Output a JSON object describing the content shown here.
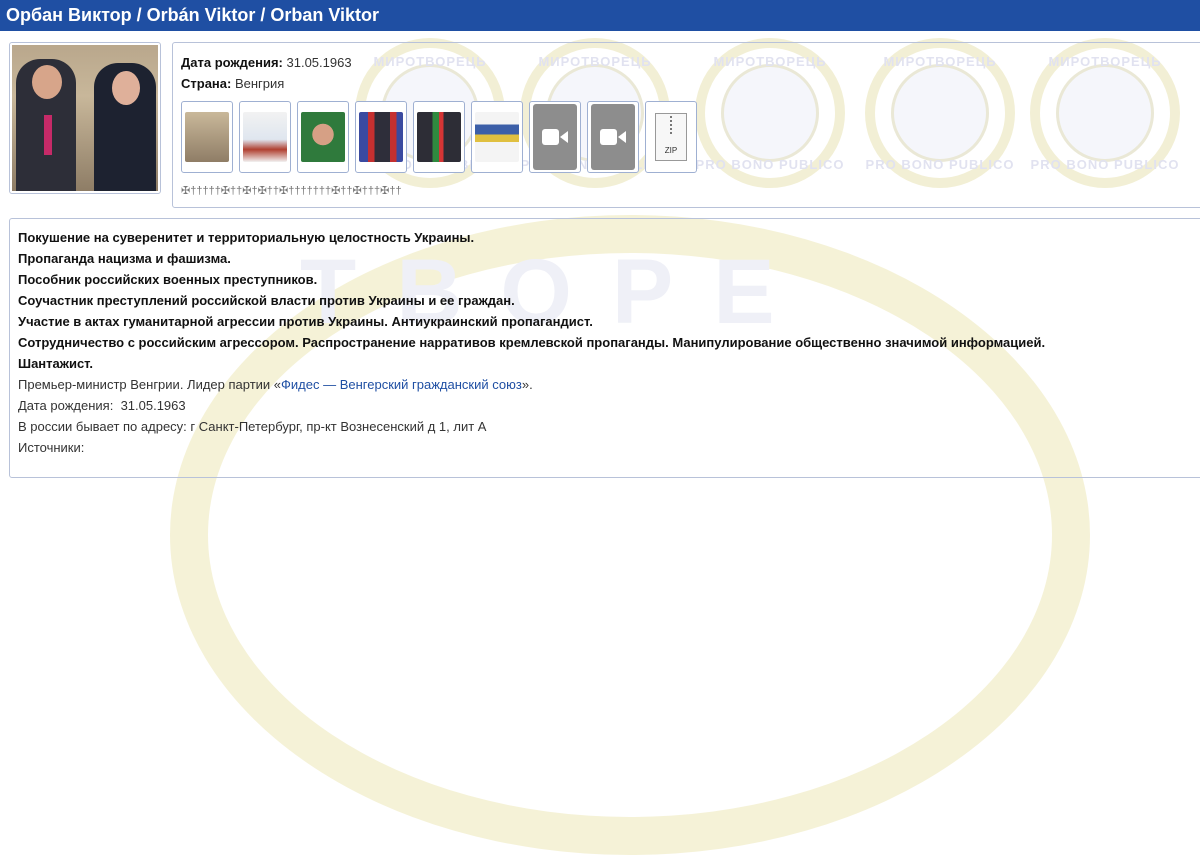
{
  "header": {
    "title": "Орбан Виктор / Orbán Viktor / Orban Viktor"
  },
  "colors": {
    "title_bar": "#1f4fa3",
    "border": "#b8c2d9",
    "watermark_gold": "#f1ecc6"
  },
  "info": {
    "birth_label": "Дата рождения:",
    "birth_value": "31.05.1963",
    "country_label": "Страна:",
    "country_value": "Венгрия"
  },
  "gallery": {
    "items": [
      {
        "type": "photo",
        "name": "photo-thumb-1"
      },
      {
        "type": "photo",
        "name": "photo-thumb-2"
      },
      {
        "type": "photo",
        "name": "photo-thumb-3"
      },
      {
        "type": "photo",
        "name": "photo-thumb-4"
      },
      {
        "type": "photo",
        "name": "photo-thumb-5"
      },
      {
        "type": "photo",
        "name": "photo-thumb-6"
      },
      {
        "type": "video",
        "name": "video-icon"
      },
      {
        "type": "video",
        "name": "video-icon"
      },
      {
        "type": "zip",
        "label": "ZIP"
      }
    ]
  },
  "crosses_row": "✠†††††✠††✠†✠††✠†††††††✠††✠†††✠††",
  "charges": [
    "Покушение на суверенитет и территориальную целостность Украины.",
    "Пропаганда нацизма и фашизма.",
    "Пособник российских военных преступников.",
    "Соучастник преступлений российской власти против Украины и ее граждан.",
    "Участие в актах гуманитарной агрессии против Украины. Антиукраинский пропагандист.",
    "Сотрудничество с российским агрессором. Распространение нарративов кремлевской пропаганды. Манипулирование общественно значимой информацией.",
    "Шантажист."
  ],
  "details": {
    "position_prefix": "Премьер-министр Венгрии. Лидер партии «",
    "party_link": "Фидес — Венгерский гражданский союз",
    "position_suffix": "».",
    "birth_line_label": "Дата рождения:",
    "birth_line_value": "31.05.1963",
    "address_line": "В россии бывает по адресу: г Санкт-Петербург, пр-кт Вознесенский д 1, лит А",
    "sources_label": "Источники:"
  },
  "watermark": {
    "ring_top": "МИРОТВОРЕЦЬ",
    "ring_bottom": "PRO BONO PUBLICO",
    "big": "ТВОРЕ"
  }
}
